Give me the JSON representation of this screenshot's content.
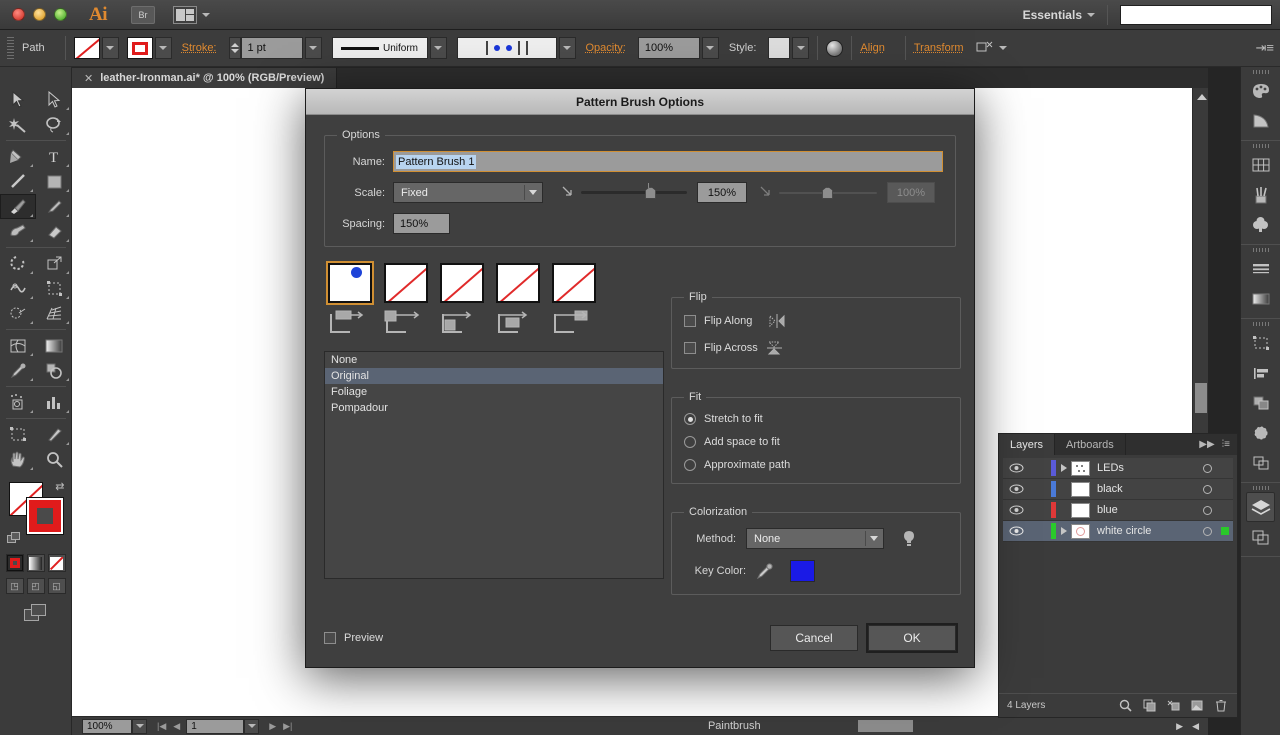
{
  "app": {
    "logo": "Ai",
    "bridge_label": "Br",
    "workspace": "Essentials",
    "search_value": ""
  },
  "control_bar": {
    "object_type": "Path",
    "fill_icon": "none-swatch-icon",
    "stroke_icon": "stroke-swatch-icon",
    "stroke_label": "Stroke:",
    "stroke_weight": "1 pt",
    "profile_label": "Uniform",
    "opacity_label": "Opacity:",
    "opacity_value": "100%",
    "style_label": "Style:",
    "align_label": "Align",
    "transform_label": "Transform",
    "recolor_icon": "recolor-artwork-icon"
  },
  "document": {
    "tab_title": "leather-Ironman.ai* @ 100% (RGB/Preview)",
    "close_icon": "close-icon"
  },
  "tools": {
    "items": [
      {
        "name": "selection-tool",
        "icon": "arrow-solid-icon"
      },
      {
        "name": "direct-selection-tool",
        "icon": "arrow-outline-icon"
      },
      {
        "name": "magic-wand-tool",
        "icon": "magic-wand-icon"
      },
      {
        "name": "lasso-tool",
        "icon": "lasso-icon"
      },
      {
        "name": "pen-tool",
        "icon": "pen-icon"
      },
      {
        "name": "type-tool",
        "icon": "type-t-icon"
      },
      {
        "name": "line-segment-tool",
        "icon": "line-icon"
      },
      {
        "name": "rectangle-tool",
        "icon": "rectangle-icon"
      },
      {
        "name": "paintbrush-tool",
        "icon": "paintbrush-icon"
      },
      {
        "name": "pencil-tool",
        "icon": "pencil-icon"
      },
      {
        "name": "blob-brush-tool",
        "icon": "blob-brush-icon"
      },
      {
        "name": "eraser-tool",
        "icon": "eraser-icon"
      },
      {
        "name": "rotate-tool",
        "icon": "rotate-icon"
      },
      {
        "name": "scale-tool",
        "icon": "scale-icon"
      },
      {
        "name": "width-tool",
        "icon": "width-icon"
      },
      {
        "name": "free-transform-tool",
        "icon": "free-transform-icon"
      },
      {
        "name": "shape-builder-tool",
        "icon": "shape-builder-icon"
      },
      {
        "name": "perspective-grid-tool",
        "icon": "perspective-grid-icon"
      },
      {
        "name": "mesh-tool",
        "icon": "mesh-icon"
      },
      {
        "name": "gradient-tool",
        "icon": "gradient-icon"
      },
      {
        "name": "eyedropper-tool",
        "icon": "eyedropper-icon"
      },
      {
        "name": "blend-tool",
        "icon": "blend-icon"
      },
      {
        "name": "symbol-sprayer-tool",
        "icon": "symbol-sprayer-icon"
      },
      {
        "name": "column-graph-tool",
        "icon": "bar-chart-icon"
      },
      {
        "name": "artboard-tool",
        "icon": "artboard-icon"
      },
      {
        "name": "slice-tool",
        "icon": "slice-knife-icon"
      },
      {
        "name": "hand-tool",
        "icon": "hand-icon"
      },
      {
        "name": "zoom-tool",
        "icon": "magnifier-icon"
      }
    ],
    "selected": "paintbrush-tool",
    "fill_icon": "fill-none-icon",
    "stroke_icon": "stroke-red-icon",
    "swap_icon": "swap-fill-stroke-icon",
    "color_modes": [
      "color-mode-icon",
      "gradient-mode-icon",
      "none-mode-icon"
    ],
    "screen_modes": [
      "normal-screen-icon",
      "full-screen-menubar-icon",
      "full-screen-icon"
    ]
  },
  "status_bar": {
    "zoom": "100%",
    "page": "1",
    "tool_name": "Paintbrush"
  },
  "right_dock": {
    "items": [
      {
        "name": "color-panel-icon"
      },
      {
        "name": "color-guide-panel-icon"
      },
      {
        "name": "swatches-panel-icon"
      },
      {
        "name": "brushes-panel-icon"
      },
      {
        "name": "symbols-panel-icon"
      },
      {
        "name": "stroke-panel-icon"
      },
      {
        "name": "gradient-panel-icon"
      },
      {
        "name": "artboards-panel-icon"
      },
      {
        "name": "align-panel-icon"
      },
      {
        "name": "pathfinder-panel-icon"
      },
      {
        "name": "transparency-panel-icon"
      },
      {
        "name": "appearance-panel-icon"
      },
      {
        "name": "layers-panel-icon"
      },
      {
        "name": "artboards-alt-panel-icon"
      }
    ],
    "active": "layers-panel-icon"
  },
  "layers_panel": {
    "tabs": [
      {
        "label": "Layers",
        "active": true
      },
      {
        "label": "Artboards",
        "active": false
      }
    ],
    "expand_icon": "double-chevron-right-icon",
    "menu_icon": "panel-menu-icon",
    "rows": [
      {
        "name": "LEDs",
        "color": "#5a5ad8",
        "has_disclosure": true,
        "selected": false,
        "targeted": false
      },
      {
        "name": "black",
        "color": "#4a7ad8",
        "has_disclosure": false,
        "selected": false,
        "targeted": false
      },
      {
        "name": "blue",
        "color": "#e03838",
        "has_disclosure": false,
        "selected": false,
        "targeted": false
      },
      {
        "name": "white circle",
        "color": "#2ac92a",
        "has_disclosure": true,
        "selected": true,
        "targeted": true
      }
    ],
    "footer_count": "4 Layers",
    "footer_icons": [
      "locate-object-icon",
      "make-clipping-mask-icon",
      "create-sublayer-icon",
      "create-new-layer-icon",
      "delete-layer-icon"
    ]
  },
  "dialog": {
    "title": "Pattern Brush Options",
    "options_legend": "Options",
    "name_label": "Name:",
    "name_value": "Pattern Brush 1",
    "scale_label": "Scale:",
    "scale_method": "Fixed",
    "scale_value": "150%",
    "scale_value_secondary": "100%",
    "spacing_label": "Spacing:",
    "spacing_value": "150%",
    "tiles": [
      {
        "name": "side-tile",
        "icon": "side-tile-icon",
        "active": true,
        "preview": "blue-dot"
      },
      {
        "name": "outer-corner-tile",
        "icon": "outer-corner-tile-icon",
        "active": false,
        "preview": "diagonal"
      },
      {
        "name": "inner-corner-tile",
        "icon": "inner-corner-tile-icon",
        "active": false,
        "preview": "diagonal"
      },
      {
        "name": "start-tile",
        "icon": "start-tile-icon",
        "active": false,
        "preview": "diagonal"
      },
      {
        "name": "end-tile",
        "icon": "end-tile-icon",
        "active": false,
        "preview": "diagonal"
      }
    ],
    "pattern_list": [
      {
        "label": "None",
        "selected": false
      },
      {
        "label": "Original",
        "selected": true
      },
      {
        "label": "Foliage",
        "selected": false
      },
      {
        "label": "Pompadour",
        "selected": false
      }
    ],
    "flip_legend": "Flip",
    "flip_along_label": "Flip Along",
    "flip_along_checked": false,
    "flip_along_icon": "flip-along-icon",
    "flip_across_label": "Flip Across",
    "flip_across_checked": false,
    "flip_across_icon": "flip-across-icon",
    "fit_legend": "Fit",
    "fit_options": [
      {
        "label": "Stretch to fit",
        "selected": true
      },
      {
        "label": "Add space to fit",
        "selected": false
      },
      {
        "label": "Approximate path",
        "selected": false
      }
    ],
    "colorization_legend": "Colorization",
    "method_label": "Method:",
    "method_value": "None",
    "tips_icon": "tips-bulb-icon",
    "key_color_label": "Key Color:",
    "key_color_picker_icon": "eyedropper-icon",
    "key_color_value": "#1a1ae6",
    "preview_label": "Preview",
    "preview_checked": false,
    "cancel_label": "Cancel",
    "ok_label": "OK"
  }
}
